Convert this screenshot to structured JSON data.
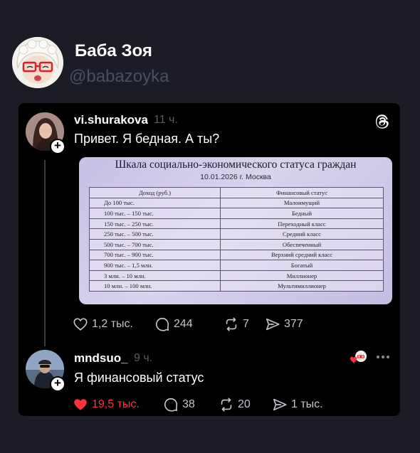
{
  "author": {
    "name": "Баба Зоя",
    "handle": "@babazoyka",
    "avatar_icon": "cartoon-grandma-avatar"
  },
  "post": {
    "username": "vi.shurakova",
    "time": "11 ч.",
    "text": "Привет. Я бедная. А ты?",
    "brand_icon": "threads-logo-icon",
    "image": {
      "title": "Шкала социально-экономического статуса граждан",
      "date": "10.01.2026 г. Москва",
      "columns": [
        "Доход (руб.)",
        "Финансовый статус"
      ],
      "rows": [
        [
          "До 100 тыс.",
          "Малоимущий"
        ],
        [
          "100 тыс. – 150 тыс.",
          "Бедный"
        ],
        [
          "150 тыс. – 250 тыс.",
          "Переходный класс"
        ],
        [
          "250 тыс. – 500 тыс.",
          "Средний класс"
        ],
        [
          "500 тыс. – 700 тыс.",
          "Обеспеченный"
        ],
        [
          "700 тыс. – 900 тыс.",
          "Верхний средний класс"
        ],
        [
          "900 тыс. – 1,5 млн.",
          "Богатый"
        ],
        [
          "3 млн. – 10 млн.",
          "Миллионер"
        ],
        [
          "10 млн. – 100 млн.",
          "Мультимиллионер"
        ]
      ]
    },
    "likes": "1,2 тыс.",
    "comments": "244",
    "reposts": "7",
    "shares": "377"
  },
  "reply": {
    "username": "mndsuo_",
    "time": "9 ч.",
    "text": "Я финансовый статус",
    "likes": "19,5 тыс.",
    "comments": "38",
    "reposts": "20",
    "shares": "1 тыс."
  },
  "colors": {
    "background": "#1c1c26",
    "card": "#000000",
    "liked": "#ff3040",
    "muted": "#5c5c66"
  }
}
